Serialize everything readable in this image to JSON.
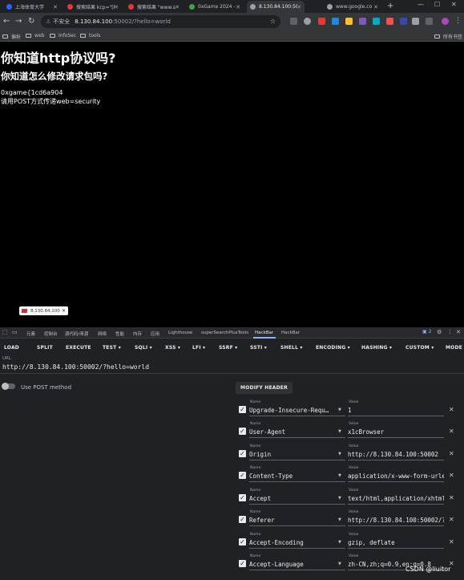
{
  "browser": {
    "tabs": [
      {
        "title": "上海体育大学",
        "color": "#2962ff"
      },
      {
        "title": "搜索结果 kcp=\"[P",
        "color": "#e53935"
      },
      {
        "title": "搜索结果 \"www.s",
        "color": "#e53935"
      },
      {
        "title": "0xGame 2024 - 7",
        "color": "#43a047"
      },
      {
        "title": "8.130.84.100:500",
        "color": "#9aa0a6"
      },
      {
        "title": "www.google.co",
        "color": "#9aa0a6"
      }
    ],
    "new_tab": "+",
    "address": {
      "security_label": "不安全",
      "host": "8.130.84.100",
      "path": ":50002/?hello=world"
    },
    "bookmarks": [
      "偏析",
      "web",
      "InfoSec",
      "tools"
    ],
    "all_bookmarks": "所有书签"
  },
  "page": {
    "h1": "你知道http协议吗?",
    "h2": "你知道怎么修改请求包吗?",
    "line1": "0xgame{1cd6a904",
    "line2": "请用POST方式传递web=security",
    "status_pill": "8.130.84.100"
  },
  "devtools": {
    "tabs": [
      "元素",
      "控制台",
      "源代码/来源",
      "网络",
      "性能",
      "内存",
      "应用",
      "Lighthouse",
      "superSearchPlusTools",
      "HackBar",
      "HackBar"
    ],
    "active_tab": "HackBar",
    "badge": "2",
    "hackbar_menu": [
      "LOAD",
      "SPLIT",
      "EXECUTE",
      "TEST ▾",
      "SQLI ▾",
      "XSS ▾",
      "LFI ▾",
      "SSRF ▾",
      "SSTI ▾",
      "SHELL ▾",
      "ENCODING ▾",
      "HASHING ▾",
      "CUSTOM ▾",
      "MODE"
    ],
    "url_label": "URL",
    "url_value": "http://8.130.84.100:50002/?hello=world",
    "post_toggle_label": "Use POST method",
    "post_enabled": false,
    "modify_header_label": "MODIFY HEADER",
    "name_label": "Name",
    "value_label": "Value",
    "headers": [
      {
        "name": "Upgrade-Insecure-Requ…",
        "value": "1"
      },
      {
        "name": "User-Agent",
        "value": "x1cBrowser"
      },
      {
        "name": "Origin",
        "value": "http://8.130.84.100:50002"
      },
      {
        "name": "Content-Type",
        "value": "application/x-www-form-urle"
      },
      {
        "name": "Accept",
        "value": "text/html,application/xhtml"
      },
      {
        "name": "Referer",
        "value": "http://8.130.84.100:50002/?"
      },
      {
        "name": "Accept-Encoding",
        "value": "gzip, deflate"
      },
      {
        "name": "Accept-Language",
        "value": "zh-CN,zh;q=0.9,en;q=0.8"
      }
    ]
  },
  "watermark": "CSDN @liuitor"
}
